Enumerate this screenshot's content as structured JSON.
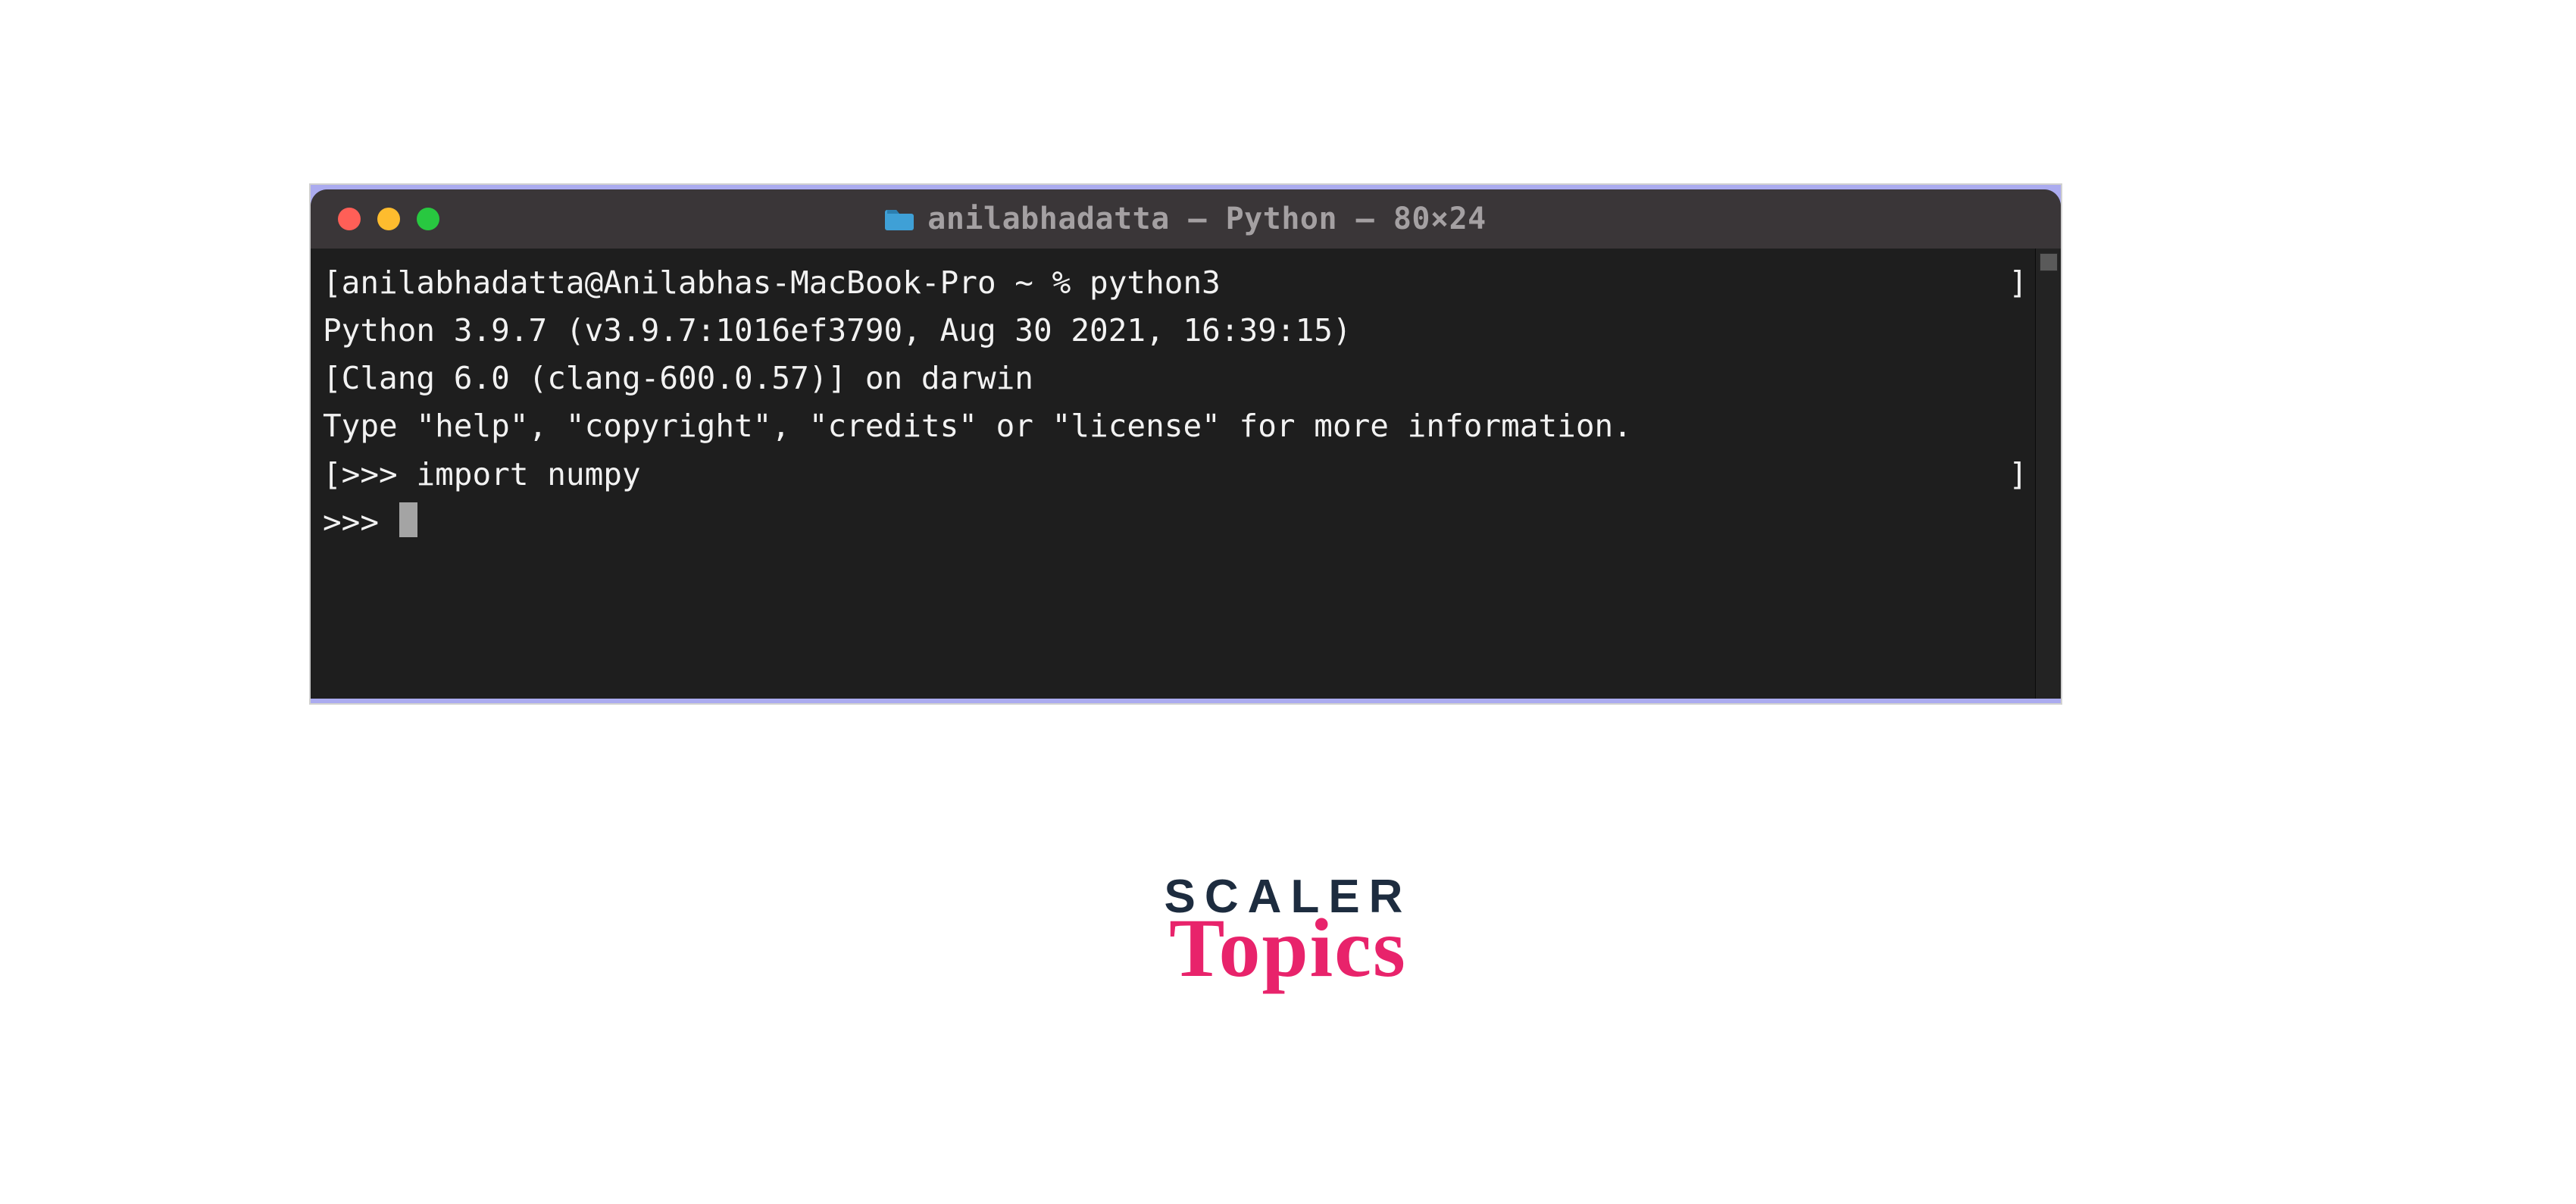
{
  "window": {
    "title": "anilabhadatta — Python — 80×24",
    "folder_icon": "folder-icon"
  },
  "terminal": {
    "line1_left": "[anilabhadatta@Anilabhas-MacBook-Pro ~ % python3",
    "line1_right": "]",
    "line2": "Python 3.9.7 (v3.9.7:1016ef3790, Aug 30 2021, 16:39:15)",
    "line3": "[Clang 6.0 (clang-600.0.57)] on darwin",
    "line4": "Type \"help\", \"copyright\", \"credits\" or \"license\" for more information.",
    "line5_left": "[>>> import numpy",
    "line5_right": "]",
    "line6": ">>> "
  },
  "logo": {
    "line1": "SCALER",
    "line2": "Topics"
  }
}
